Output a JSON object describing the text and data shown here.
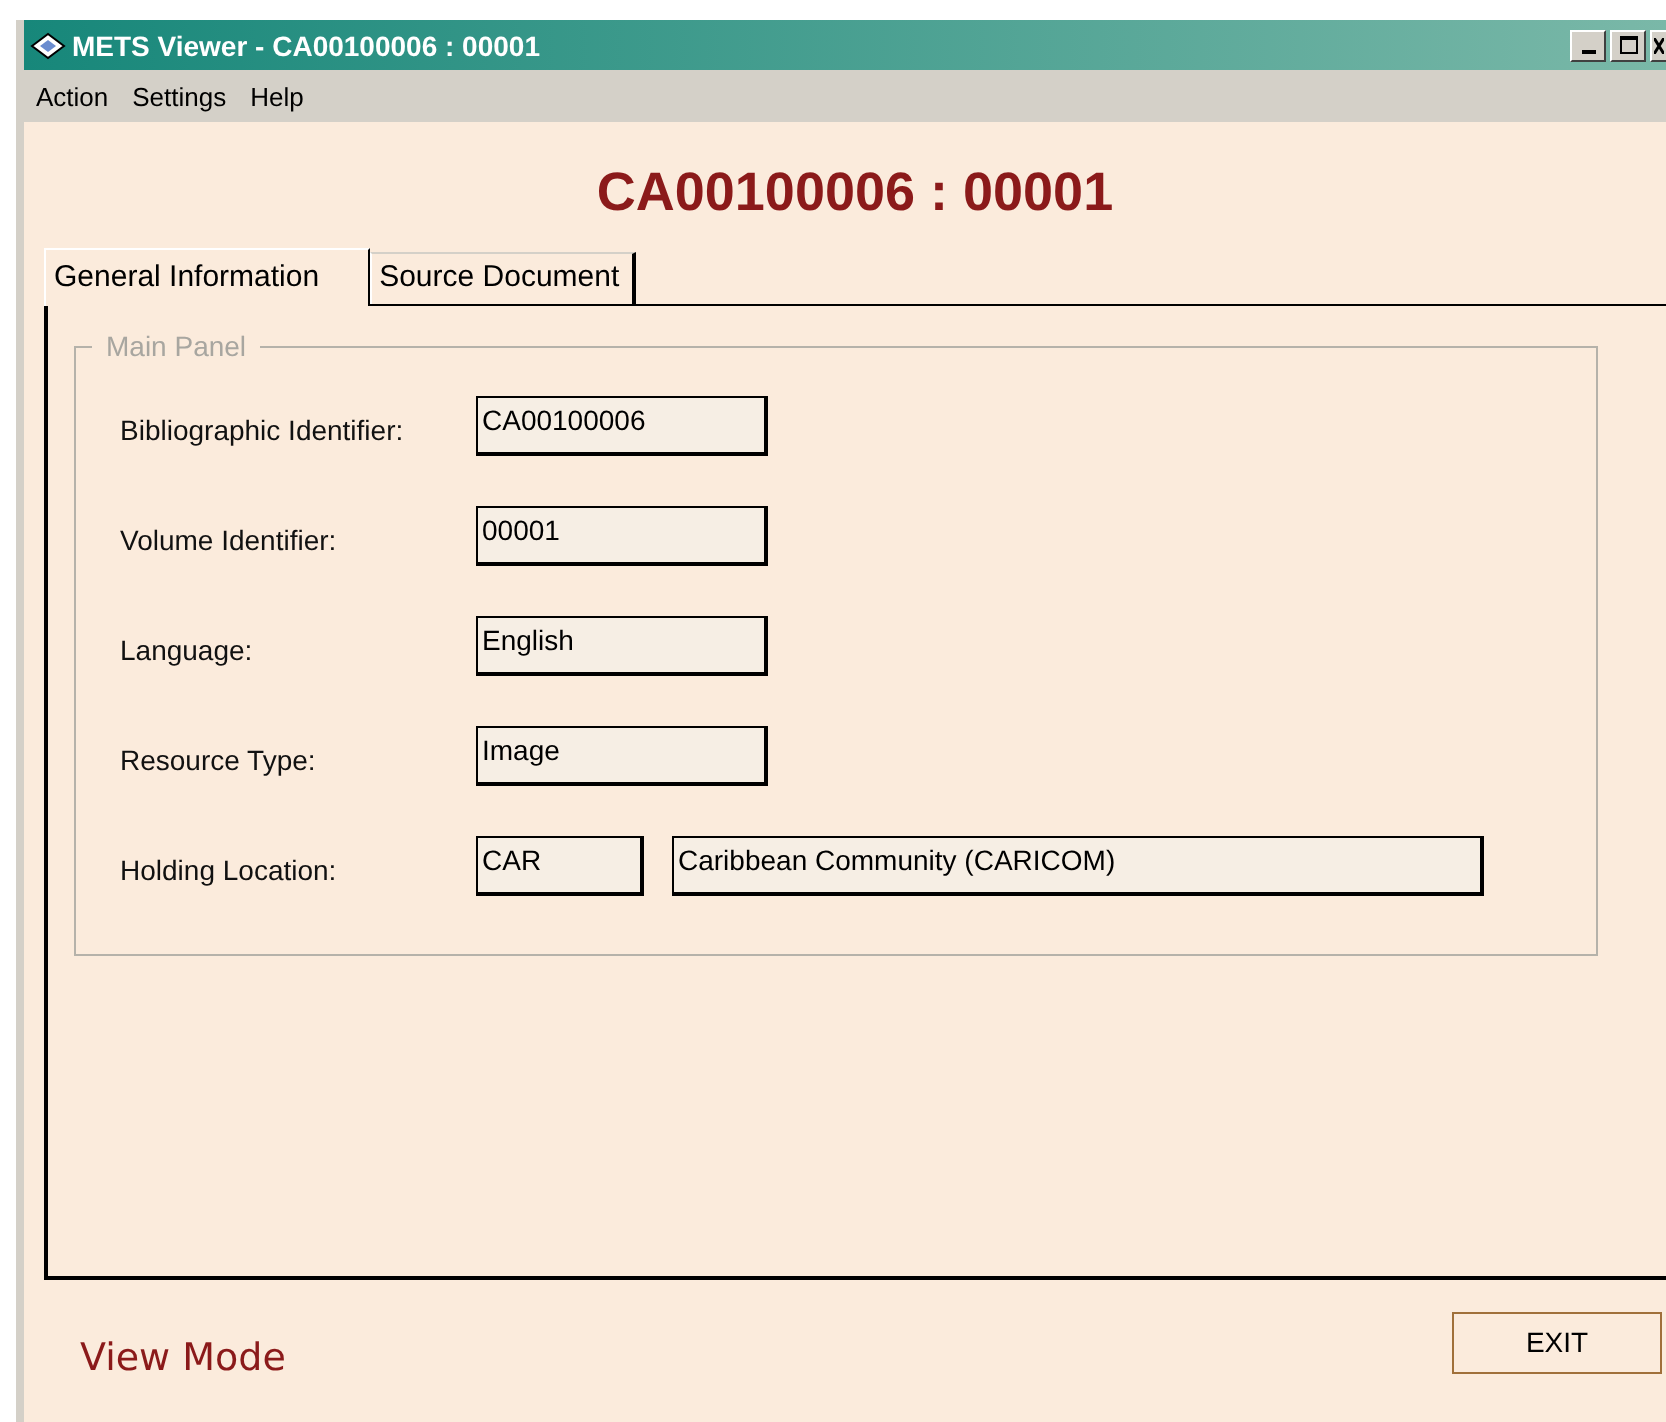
{
  "window": {
    "title": "METS Viewer - CA00100006 : 00001"
  },
  "menu": [
    "Action",
    "Settings",
    "Help"
  ],
  "heading": "CA00100006 : 00001",
  "tabs": [
    {
      "label": "General Information",
      "selected": true
    },
    {
      "label": "Source Document",
      "selected": false
    }
  ],
  "panel": {
    "title": "Main Panel",
    "fields": [
      {
        "label": "Bibliographic Identifier:",
        "values": [
          "CA00100006"
        ]
      },
      {
        "label": "Volume Identifier:",
        "values": [
          "00001"
        ]
      },
      {
        "label": "Language:",
        "values": [
          "English"
        ]
      },
      {
        "label": "Resource Type:",
        "values": [
          "Image"
        ]
      },
      {
        "label": "Holding Location:",
        "values": [
          "CAR",
          "Caribbean Community (CARICOM)"
        ]
      }
    ]
  },
  "status": "View Mode",
  "buttons": [
    "EXIT"
  ]
}
